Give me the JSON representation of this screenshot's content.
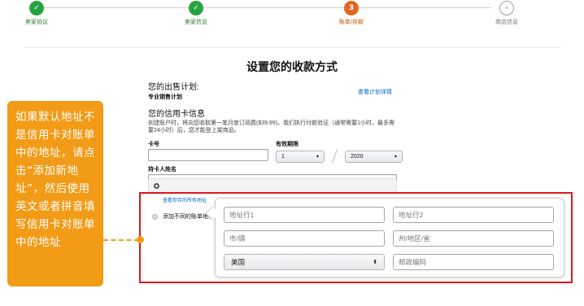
{
  "steps": [
    {
      "label": "卖家协议",
      "state": "done",
      "symbol": "✓"
    },
    {
      "label": "卖家信息",
      "state": "done",
      "symbol": "✓"
    },
    {
      "label": "账单/存款",
      "state": "active",
      "symbol": "3"
    },
    {
      "label": "商店信息",
      "state": "pending",
      "symbol": "‹"
    }
  ],
  "page_title": "设置您的收款方式",
  "plan": {
    "label": "您的出售计划:",
    "value": "专业销售计划",
    "link": "查看计划详情"
  },
  "credit_card": {
    "title": "您的信用卡信息",
    "description": "创建账户时，将向您收取第一笔月度订阅费($39.99)。我们执行付款验证（通常需要1小时，最多需要24小时）后，您才能登上架商品。",
    "card_number_label": "卡号",
    "expiry_label": "有效期限",
    "expiry_month": "1",
    "expiry_year": "2020",
    "holder_label": "持卡人姓名"
  },
  "address_options": {
    "view_all_link": "查看你存的所有地址",
    "add_new_label": "添加不同的账单地址"
  },
  "address_form": {
    "line1_placeholder": "地址行1",
    "line2_placeholder": "地址行2",
    "city_placeholder": "市/镇",
    "state_placeholder": "州/地区/省",
    "country_value": "美国",
    "zip_placeholder": "邮政编码"
  },
  "callout": {
    "text": "如果默认地址不是信用卡对账单中的地址，请点击“添加新地址”，然后使用英文或者拼音填写信用卡对账单中的地址"
  },
  "colors": {
    "done": "#26a341",
    "active": "#e1661f",
    "callout": "#f29b17",
    "highlight_border": "#e0161d",
    "link": "#0066c0"
  }
}
